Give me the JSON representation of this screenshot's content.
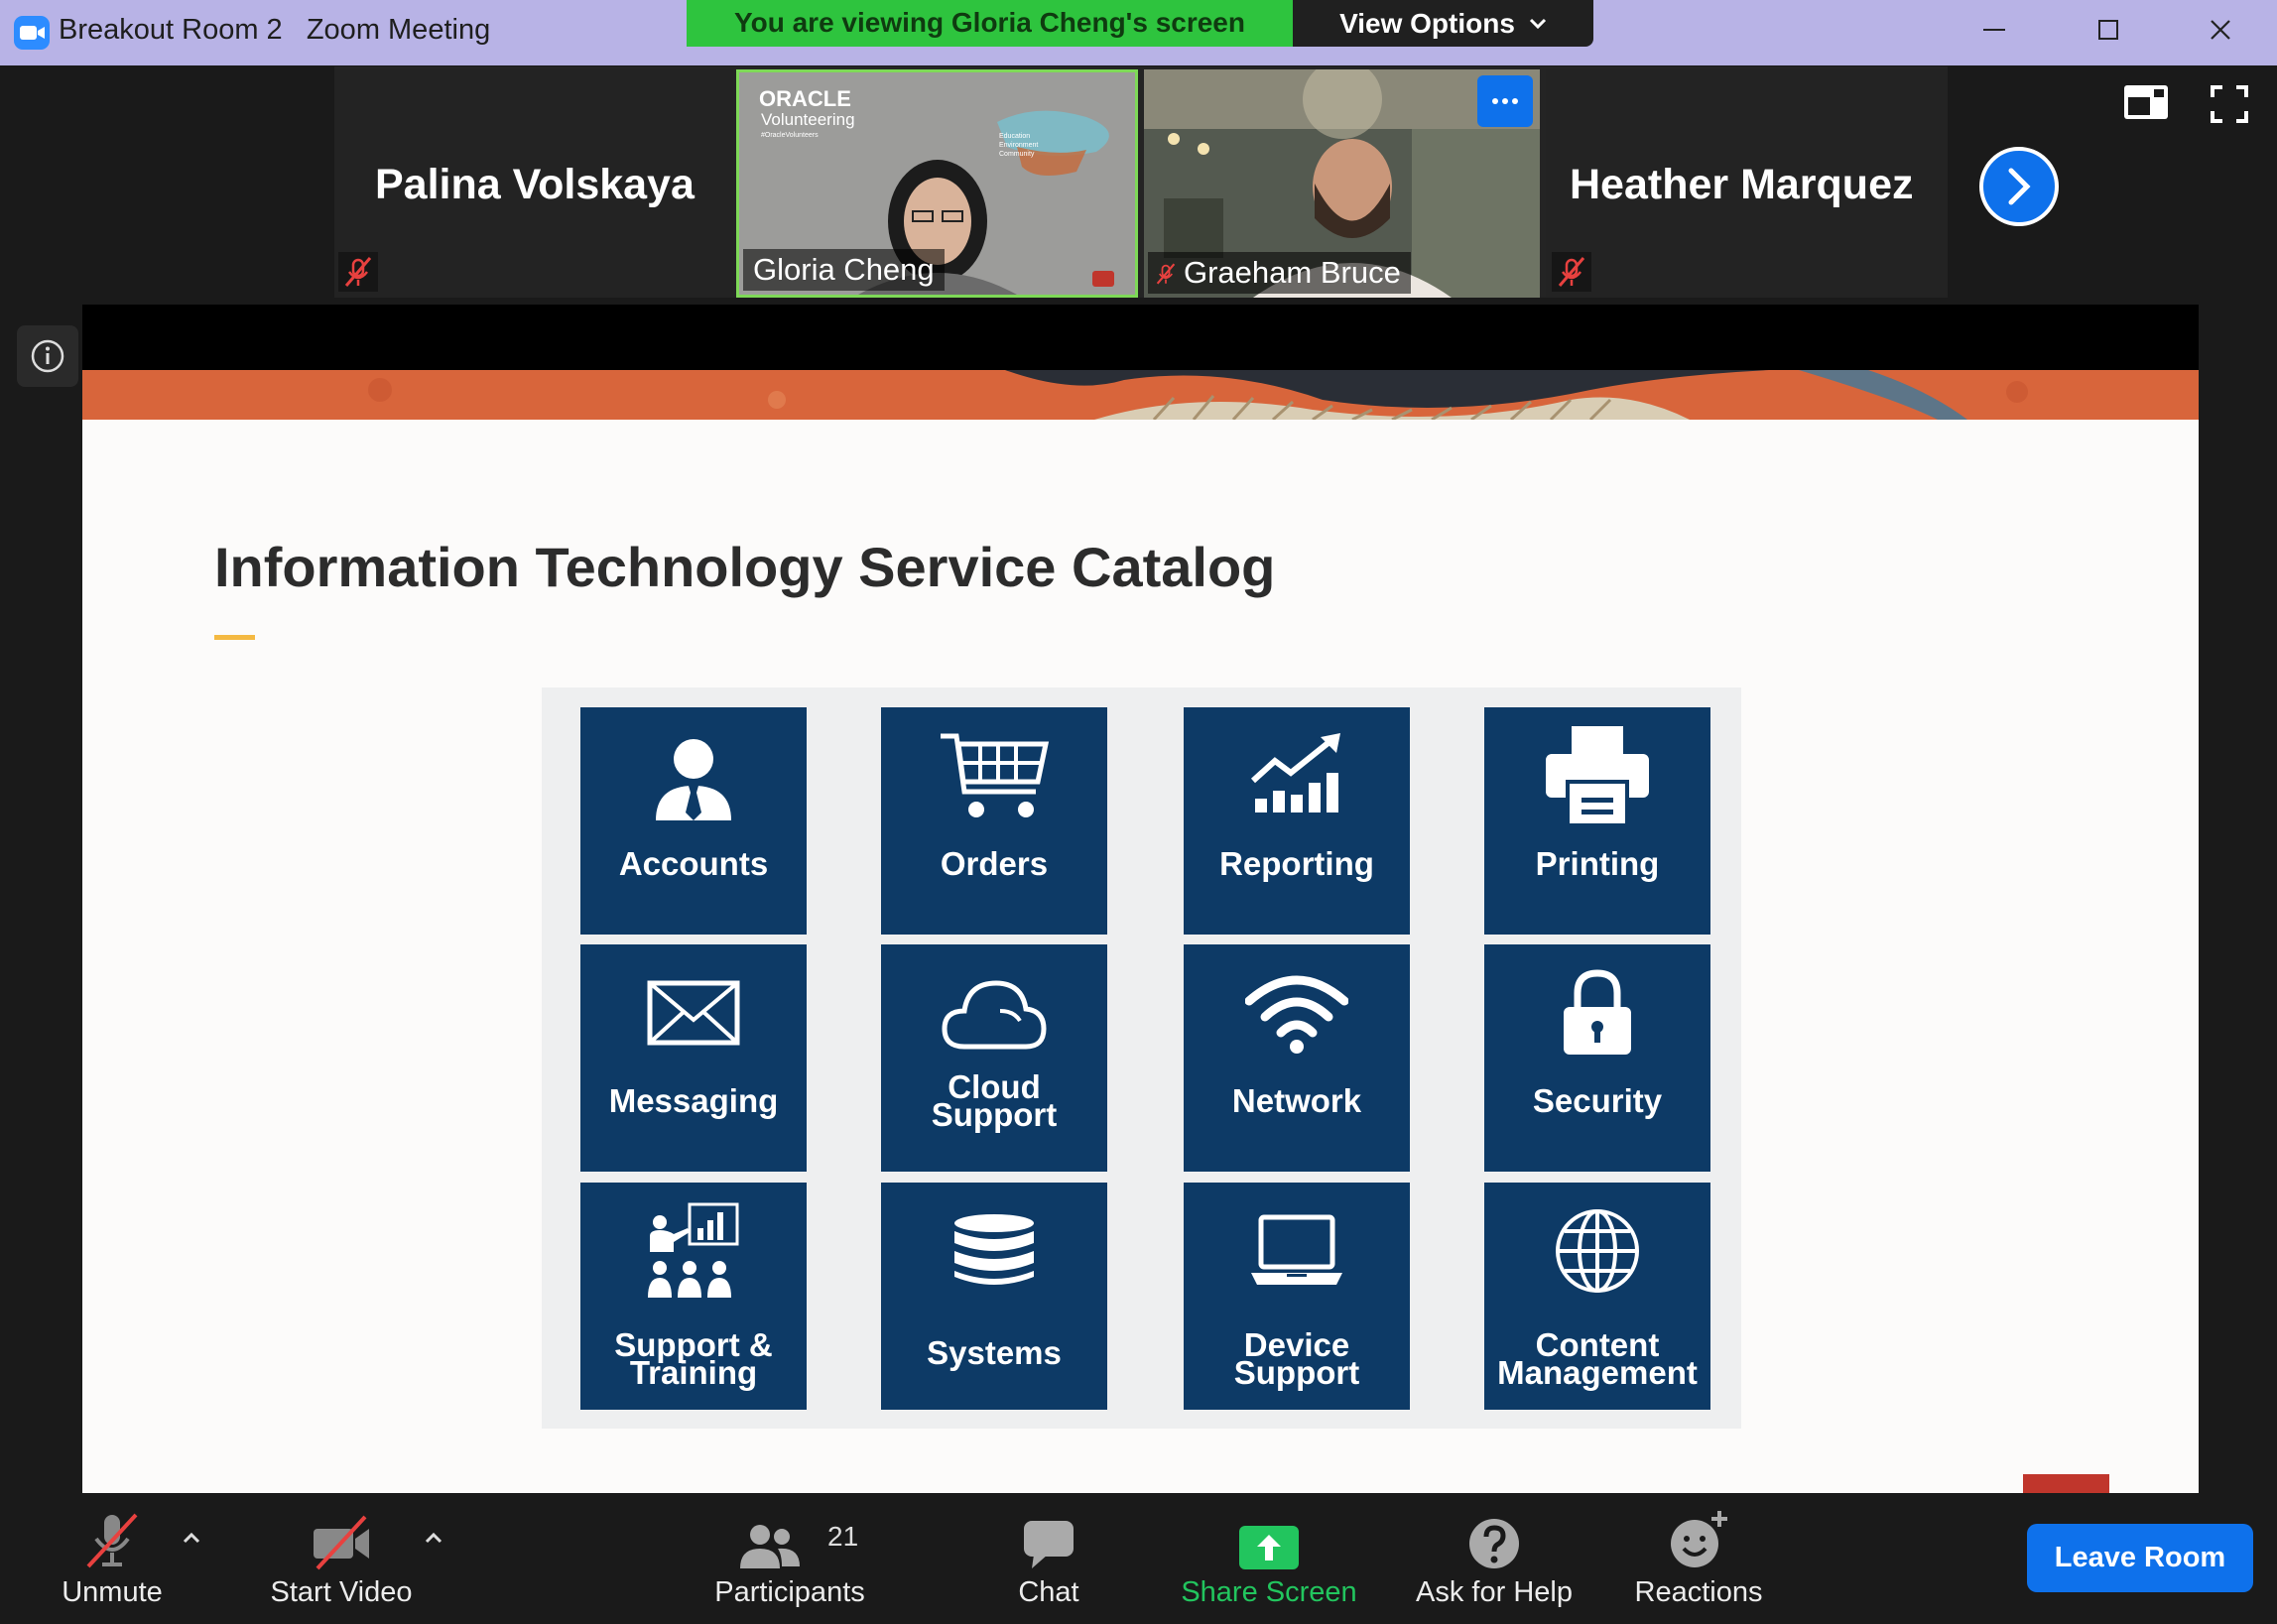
{
  "window": {
    "title": "Breakout Room 2   Zoom Meeting",
    "share_banner": "You are viewing Gloria Cheng's screen",
    "view_options_label": "View Options"
  },
  "participants": [
    {
      "name": "Palina Volskaya",
      "muted": true,
      "video": false
    },
    {
      "name": "Gloria Cheng",
      "muted": false,
      "video": true,
      "active_speaker": true
    },
    {
      "name": "Graeham Bruce",
      "muted": true,
      "video": true
    },
    {
      "name": "Heather Marquez",
      "muted": true,
      "video": false
    }
  ],
  "gloria_video": {
    "brand": "ORACLE",
    "sub": "Volunteering",
    "tag": "#OracleVolunteers",
    "vertical": "Education Environment Community"
  },
  "slide": {
    "title": "Information Technology Service Catalog",
    "services": [
      {
        "label": "Accounts",
        "icon": "person-icon"
      },
      {
        "label": "Orders",
        "icon": "shopping-cart-icon"
      },
      {
        "label": "Reporting",
        "icon": "bar-chart-trend-icon"
      },
      {
        "label": "Printing",
        "icon": "printer-icon"
      },
      {
        "label": "Messaging",
        "icon": "envelope-icon"
      },
      {
        "label": "Cloud Support",
        "line1": "Cloud",
        "line2": "Support",
        "icon": "cloud-icon"
      },
      {
        "label": "Network",
        "icon": "wifi-icon"
      },
      {
        "label": "Security",
        "icon": "padlock-icon"
      },
      {
        "label": "Support & Training",
        "line1": "Support &",
        "line2": "Training",
        "icon": "presentation-icon"
      },
      {
        "label": "Systems",
        "icon": "database-icon"
      },
      {
        "label": "Device Support",
        "line1": "Device",
        "line2": "Support",
        "icon": "laptop-icon"
      },
      {
        "label": "Content Management",
        "line1": "Content",
        "line2": "Management",
        "icon": "globe-icon"
      }
    ]
  },
  "toolbar": {
    "unmute": "Unmute",
    "start_video": "Start Video",
    "participants": "Participants",
    "participants_count": "21",
    "chat": "Chat",
    "share_screen": "Share Screen",
    "ask_for_help": "Ask for Help",
    "reactions": "Reactions",
    "leave_room": "Leave Room"
  },
  "colors": {
    "titlebar": "#b8b3e6",
    "share_banner": "#2ec43e",
    "zoom_blue": "#0e71eb",
    "tile_navy": "#0d3a66",
    "share_green": "#22c55e",
    "mute_red": "#e8413f"
  }
}
